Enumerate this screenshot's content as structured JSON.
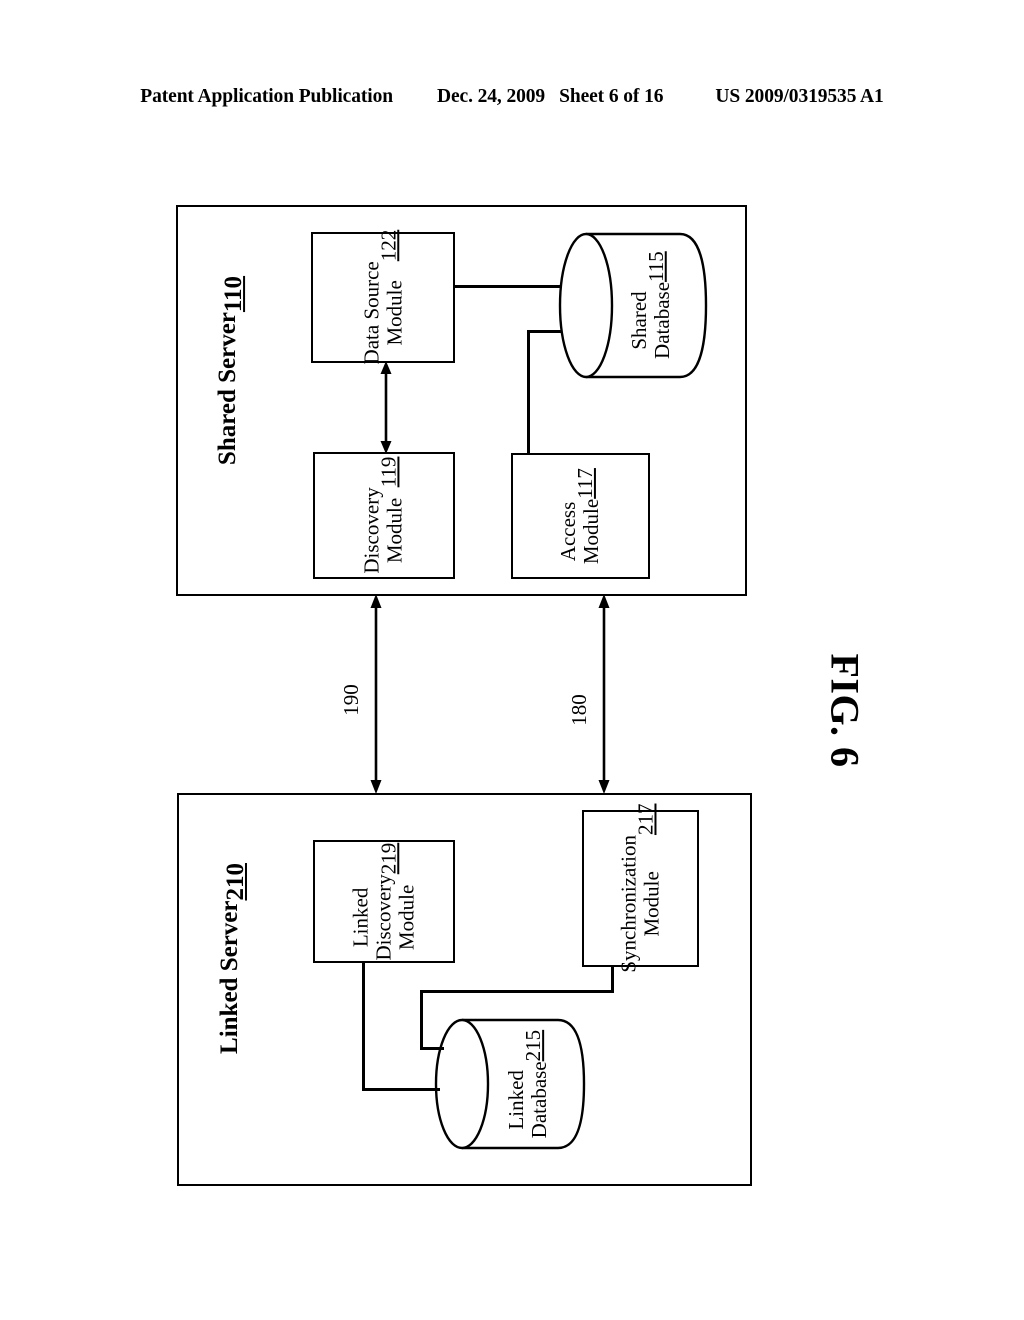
{
  "header": {
    "left": "Patent Application Publication",
    "date": "Dec. 24, 2009",
    "sheet": "Sheet 6 of 16",
    "number": "US 2009/0319535 A1"
  },
  "figure": {
    "caption": "FIG. 6",
    "type": "block-diagram",
    "orientation": "landscape-rotated-90"
  },
  "shared_server": {
    "title": "Shared Server",
    "ref": "110",
    "modules": [
      {
        "name": "Data Source Module",
        "line1": "Data Source",
        "line2": "Module",
        "ref": "122"
      },
      {
        "name": "Discovery Module",
        "line1": "Discovery",
        "line2": "Module",
        "ref": "119"
      },
      {
        "name": "Access Module",
        "line1": "Access",
        "line2": "Module",
        "ref": "117"
      }
    ],
    "database": {
      "line1": "Shared",
      "line2": "Database",
      "ref": "115"
    }
  },
  "linked_server": {
    "title": "Linked Server",
    "ref": "210",
    "modules": [
      {
        "name": "Linked Discovery Module",
        "line1": "Linked",
        "line2": "Discovery",
        "line3": "Module",
        "ref": "219"
      },
      {
        "name": "Synchronization Module",
        "line1": "Synchronization",
        "line2": "Module",
        "ref": "217"
      }
    ],
    "database": {
      "line1": "Linked",
      "line2": "Database",
      "ref": "215"
    }
  },
  "connectors": [
    {
      "name": "discovery-link",
      "label": "190"
    },
    {
      "name": "access-sync-link",
      "label": "180"
    }
  ],
  "colors": {
    "ink": "#000000",
    "paper": "#ffffff"
  }
}
